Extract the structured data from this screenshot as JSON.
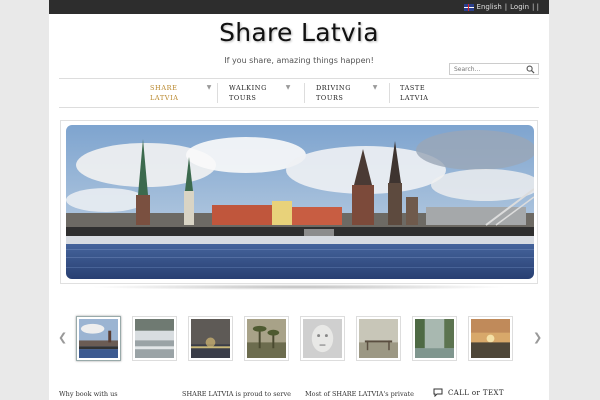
{
  "topbar": {
    "language": "English",
    "separator1": " | ",
    "login": "Login",
    "separator2": " | |"
  },
  "site": {
    "title": "Share Latvia",
    "tagline": "If you share, amazing things happen!"
  },
  "search": {
    "placeholder": "Search..."
  },
  "nav": [
    {
      "line1": "SHARE",
      "line2": "LATVIA"
    },
    {
      "line1": "WALKING",
      "line2": "TOURS"
    },
    {
      "line1": "DRIVING",
      "line2": "TOURS"
    },
    {
      "line1": "TASTE",
      "line2": "LATVIA"
    }
  ],
  "slider": {
    "active_thumb": 1,
    "prev_icon": "arrow-left-icon",
    "next_icon": "arrow-right-icon"
  },
  "thumbnails": [
    "riga-skyline",
    "waterfall",
    "city-night",
    "palm-trees",
    "sculpture",
    "pier",
    "river",
    "sunset"
  ],
  "bottom": {
    "col1": "Why book with us",
    "col2": "SHARE LATVIA is proud to serve",
    "col3": "Most of SHARE LATVIA's private",
    "call": "CALL or TEXT"
  },
  "colors": {
    "accent": "#b8862a",
    "topbar": "#2d2d2d"
  }
}
